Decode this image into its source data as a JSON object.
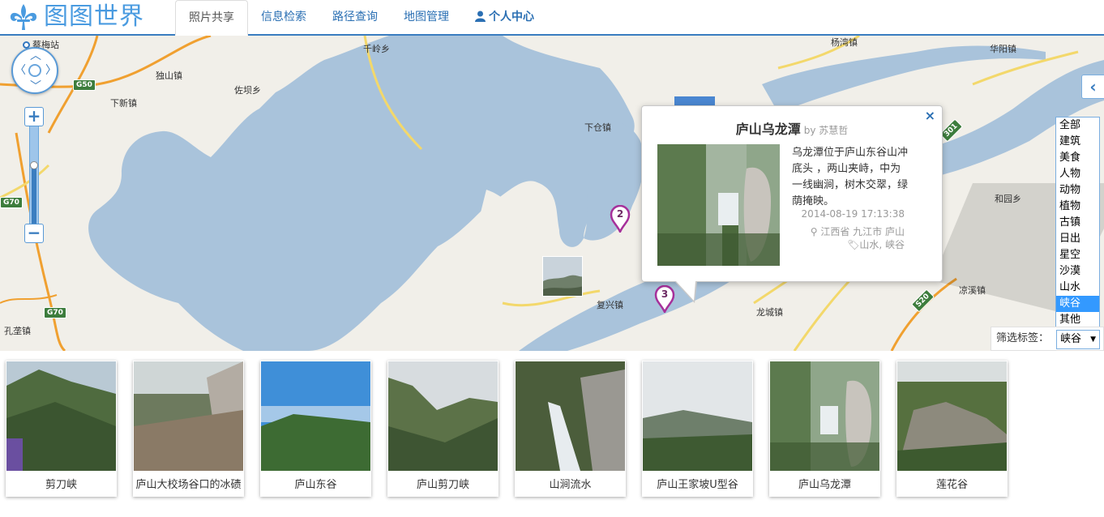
{
  "app": {
    "logo_text": "图图世界",
    "logo_icon": "fleur-de-lis-icon",
    "accent": "#3a7dc0"
  },
  "nav": {
    "tabs": [
      {
        "label": "照片共享",
        "active": true
      },
      {
        "label": "信息检索"
      },
      {
        "label": "路径查询"
      },
      {
        "label": "地图管理"
      },
      {
        "label": "个人中心",
        "icon": "user-icon"
      }
    ]
  },
  "map": {
    "colors": {
      "land": "#f1efe9",
      "water": "#a9c3db",
      "road_yellow": "#f3d86b",
      "road_orange": "#f0a030"
    },
    "places": [
      "蔡梅站",
      "独山镇",
      "佐坝乡",
      "下新镇",
      "千岭乡",
      "下仓镇",
      "杨湾镇",
      "华阳镇",
      "和园乡",
      "复兴镇",
      "龙城镇",
      "凉溪镇",
      "孔垄镇"
    ],
    "highways": [
      "G50",
      "G70",
      "G70",
      "S20",
      "301"
    ],
    "markers": [
      "2",
      "3"
    ],
    "zoom_level": 0.6
  },
  "popup": {
    "title": "庐山乌龙潭",
    "author": "by 苏慧哲",
    "description": "乌龙潭位于庐山东谷山冲底头 ，两山夹峙，中为一线幽涧，树木交翠，绿荫掩映。",
    "time": "2014-08-19 17:13:38",
    "location": "江西省 九江市 庐山",
    "tags": "山水, 峡谷",
    "close": "×"
  },
  "filter": {
    "label": "筛选标签：",
    "selected": "峡谷",
    "options": [
      "全部",
      "建筑",
      "美食",
      "人物",
      "动物",
      "植物",
      "古镇",
      "日出",
      "星空",
      "沙漠",
      "山水",
      "峡谷",
      "其他"
    ]
  },
  "photos": [
    {
      "caption": "剪刀峡"
    },
    {
      "caption": "庐山大校场谷口的冰碛"
    },
    {
      "caption": "庐山东谷"
    },
    {
      "caption": "庐山剪刀峡"
    },
    {
      "caption": "山涧流水"
    },
    {
      "caption": "庐山王家坡U型谷"
    },
    {
      "caption": "庐山乌龙潭"
    },
    {
      "caption": "莲花谷"
    }
  ]
}
